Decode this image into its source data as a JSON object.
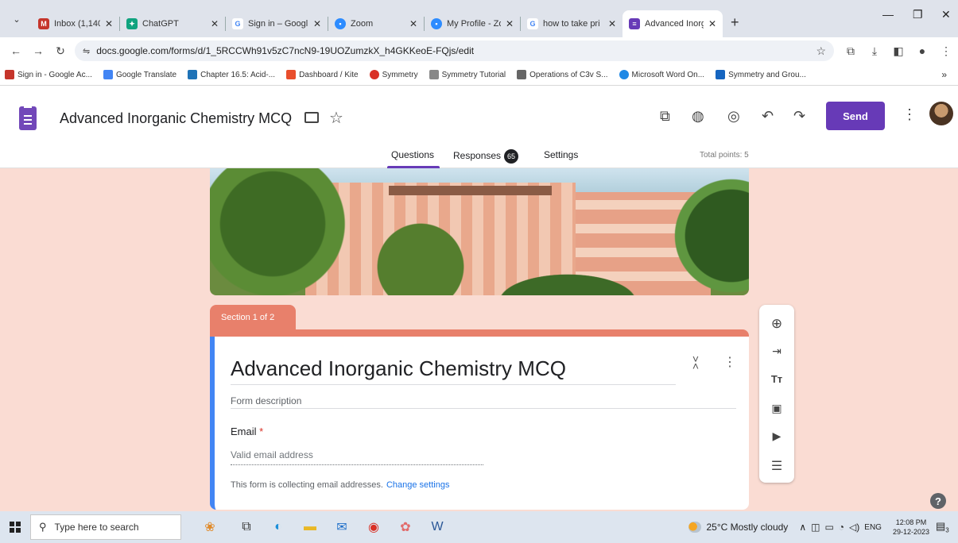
{
  "browser": {
    "tabs": [
      {
        "title": "Inbox (1,140) - ",
        "icon": "mail-icon",
        "color": "#c5352b"
      },
      {
        "title": "ChatGPT",
        "icon": "chatgpt-icon",
        "color": "#10a37f"
      },
      {
        "title": "Sign in – Googl",
        "icon": "google-icon",
        "color": "#4285f4"
      },
      {
        "title": "Zoom",
        "icon": "zoom-icon",
        "color": "#2d8cff"
      },
      {
        "title": "My Profile - Zoo",
        "icon": "zoom-icon",
        "color": "#2d8cff"
      },
      {
        "title": "how to take pri",
        "icon": "google-icon",
        "color": "#4285f4"
      },
      {
        "title": "Advanced Inorg",
        "icon": "forms-icon",
        "color": "#673ab7",
        "active": true
      }
    ],
    "url": "docs.google.com/forms/d/1_5RCCWh91v5zC7ncN9-19UOZumzkX_h4GKKeoE-FQjs/edit",
    "bookmarks": [
      {
        "label": "Sign in - Google Ac...",
        "color": "#c5352b"
      },
      {
        "label": "Google Translate",
        "color": "#4285f4"
      },
      {
        "label": "Chapter 16.5: Acid-...",
        "color": "#1f73b7"
      },
      {
        "label": "Dashboard / Kite",
        "color": "#e94e2c"
      },
      {
        "label": "Symmetry",
        "color": "#d93025"
      },
      {
        "label": "Symmetry Tutorial",
        "color": "#888888"
      },
      {
        "label": "Operations of C3v S...",
        "color": "#666666"
      },
      {
        "label": "Microsoft Word On...",
        "color": "#1e88e5"
      },
      {
        "label": "Symmetry and Grou...",
        "color": "#1565c0"
      }
    ],
    "bookmarks_more": "»"
  },
  "header": {
    "doc_title": "Advanced Inorganic Chemistry MCQ",
    "send_label": "Send",
    "tabs": {
      "questions": "Questions",
      "responses": "Responses",
      "responses_count": "65",
      "settings": "Settings"
    },
    "total_points": "Total points: 5"
  },
  "section": {
    "label": "Section 1 of 2"
  },
  "form": {
    "title": "Advanced Inorganic Chemistry MCQ",
    "description_placeholder": "Form description",
    "email_label": "Email",
    "required_mark": "*",
    "email_placeholder": "Valid email address",
    "collect_note": "This form is collecting email addresses.",
    "change_settings": "Change settings"
  },
  "toolbar": {
    "items": [
      "add-question-icon",
      "import-questions-icon",
      "add-title-icon",
      "add-image-icon",
      "add-video-icon",
      "add-section-icon"
    ]
  },
  "taskbar": {
    "search_placeholder": "Type here to search",
    "weather": "25°C  Mostly cloudy",
    "lang": "ENG",
    "time": "12:08 PM",
    "date": "29-12-2023",
    "notif_count": "3"
  },
  "colors": {
    "accent": "#673ab7",
    "section": "#e8806b",
    "page_bg": "#fadcd3",
    "card_border": "#4285f4"
  }
}
